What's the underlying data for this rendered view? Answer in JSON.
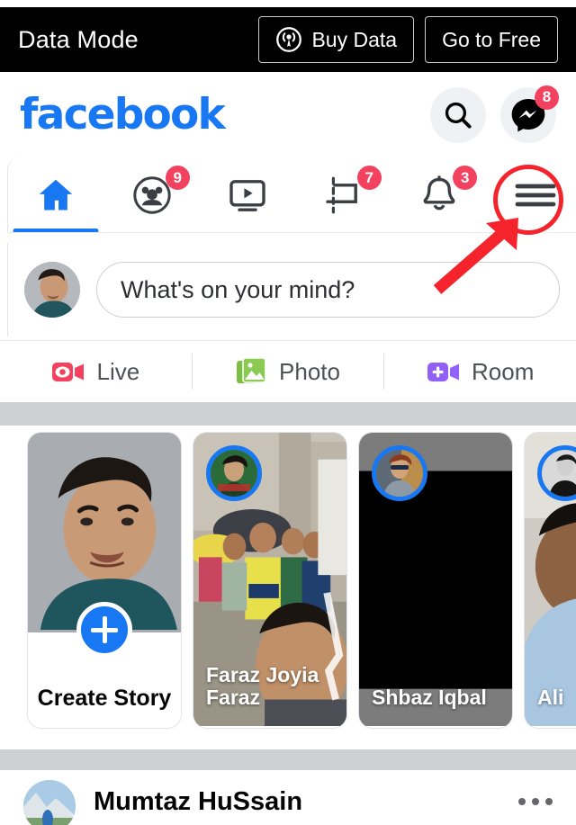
{
  "data_mode_bar": {
    "title": "Data Mode",
    "buy_data_label": "Buy Data",
    "buy_data_icon": "broadcast-icon",
    "go_to_free_label": "Go to Free"
  },
  "header": {
    "logo_text": "facebook",
    "logo_color": "#1877F2",
    "search_icon": "search-icon",
    "messenger_icon": "messenger-icon",
    "messenger_badge": "8"
  },
  "nav": {
    "tabs": [
      {
        "name": "home",
        "icon": "home-icon",
        "active": true,
        "badge": ""
      },
      {
        "name": "friends",
        "icon": "friends-icon",
        "active": false,
        "badge": "9"
      },
      {
        "name": "watch",
        "icon": "video-icon",
        "active": false,
        "badge": ""
      },
      {
        "name": "marketplace",
        "icon": "marketplace-icon",
        "active": false,
        "badge": "7"
      },
      {
        "name": "notifications",
        "icon": "bell-icon",
        "active": false,
        "badge": "3"
      },
      {
        "name": "menu",
        "icon": "hamburger-menu-icon",
        "active": false,
        "badge": ""
      }
    ],
    "active_color": "#1877F2",
    "badge_color": "#F3425F"
  },
  "composer": {
    "avatar": "user-avatar",
    "placeholder": "What's on your mind?"
  },
  "actions": [
    {
      "label": "Live",
      "icon": "live-video-icon",
      "color": "#F3425F"
    },
    {
      "label": "Photo",
      "icon": "photo-icon",
      "color": "#7CC043"
    },
    {
      "label": "Room",
      "icon": "room-camera-icon",
      "color": "#9360F7"
    }
  ],
  "stories": {
    "create": {
      "label": "Create Story",
      "icon": "plus-icon"
    },
    "items": [
      {
        "name": "Faraz Joyia Faraz"
      },
      {
        "name": "Shbaz Iqbal"
      },
      {
        "name": "Ali"
      }
    ]
  },
  "post": {
    "author": "Mumtaz HuSsain",
    "more_icon": "more-options-icon"
  },
  "annotations": {
    "circle_target": "hamburger-menu-icon",
    "arrow": "pointer-arrow",
    "color": "#F5232C"
  }
}
